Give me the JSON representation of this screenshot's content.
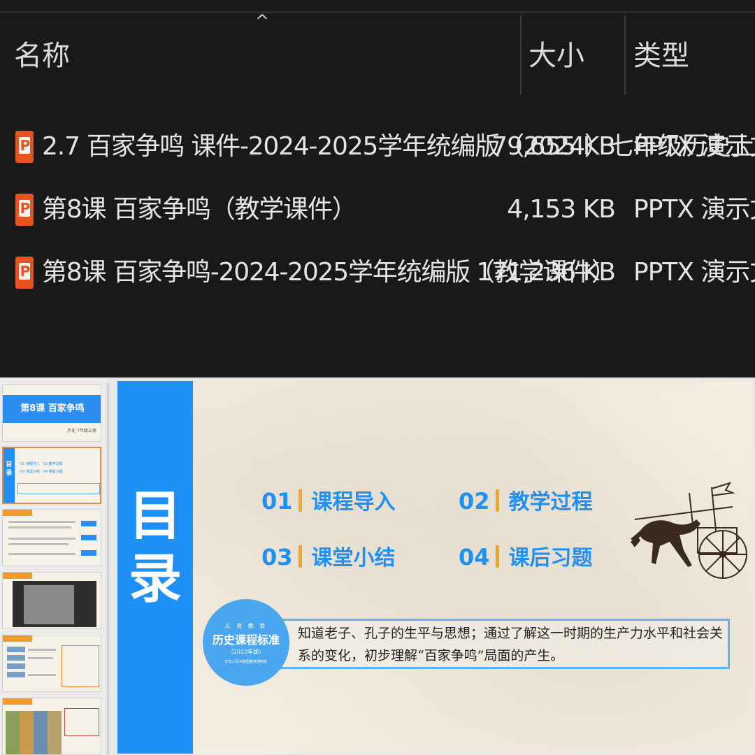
{
  "explorer": {
    "columns": {
      "name": "名称",
      "size": "大小",
      "type": "类型"
    },
    "sort_indicator": "^",
    "files": [
      {
        "name": "2.7 百家争鸣 课件-2024-2025学年统编版（2024）七年级历史上册",
        "size": "79,655 KB",
        "type": "PPTX 演示文稿",
        "icon": "pptx-file-icon"
      },
      {
        "name": "第8课 百家争鸣（教学课件）",
        "size": "4,153 KB",
        "type": "PPTX 演示文稿",
        "icon": "pptx-file-icon"
      },
      {
        "name": "第8课 百家争鸣-2024-2025学年统编版（教学课件）",
        "size": "171,236 KB",
        "type": "PPTX 演示文稿",
        "icon": "pptx-file-icon"
      }
    ]
  },
  "ppt": {
    "thumbnails": {
      "t1_title": "第8课 百家争鸣",
      "t1_sub": "历史 7年级上册",
      "t2_side": "目录",
      "t2_items": [
        "01 课程导入",
        "02 教学过程",
        "03 课堂小结",
        "04 课后习题"
      ]
    },
    "slide": {
      "title": "目录",
      "toc": [
        {
          "num": "01",
          "label": "课程导入"
        },
        {
          "num": "02",
          "label": "教学过程"
        },
        {
          "num": "03",
          "label": "课堂小结"
        },
        {
          "num": "04",
          "label": "课后习题"
        }
      ],
      "standard_badge": {
        "top": "义 务 教 育",
        "title": "历史课程标准",
        "edition": "（2022年版）",
        "publisher": "中华人民共和国教育部制定"
      },
      "standard_text": "知道老子、孔子的生平与思想；通过了解这一时期的生产力水平和社会关系的变化，初步理解“百家争鸣”局面的产生。"
    },
    "colors": {
      "accent_blue": "#1e90f6",
      "accent_orange": "#f5a623",
      "file_icon": "#e8521e"
    }
  }
}
